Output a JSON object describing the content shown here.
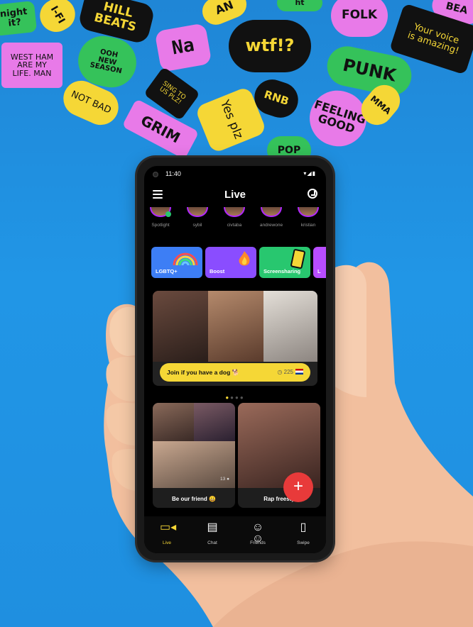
{
  "stickers": [
    {
      "text": "night\nit?",
      "bg": "#35c25a",
      "fg": "#111111"
    },
    {
      "text": "I-FI",
      "bg": "#f5d736",
      "fg": "#111111"
    },
    {
      "text": "HILL\nBEATS",
      "bg": "#111111",
      "fg": "#f5d736"
    },
    {
      "text": "AN",
      "bg": "#f5d736",
      "fg": "#111111"
    },
    {
      "text": "ht",
      "bg": "#35c25a",
      "fg": "#111111"
    },
    {
      "text": "FOLK",
      "bg": "#e87ae8",
      "fg": "#111111"
    },
    {
      "text": "BEA",
      "bg": "#e87ae8",
      "fg": "#111111"
    },
    {
      "text": "WEST HAM\nARE MY\nLIFE. MAN",
      "bg": "#e87ae8",
      "fg": "#111111"
    },
    {
      "text": "OOH\nNEW\nSEASON",
      "bg": "#35c25a",
      "fg": "#111111"
    },
    {
      "text": "Na",
      "bg": "#e87ae8",
      "fg": "#111111"
    },
    {
      "text": "wtf!?",
      "bg": "#111111",
      "fg": "#f5d736"
    },
    {
      "text": "Your voice\nis amazing!",
      "bg": "#111111",
      "fg": "#f5d736"
    },
    {
      "text": "PUNK",
      "bg": "#35c25a",
      "fg": "#111111"
    },
    {
      "text": "NOT BAD",
      "bg": "#f5d736",
      "fg": "#111111"
    },
    {
      "text": "SING TO\nUS PLZ!",
      "bg": "#111111",
      "fg": "#f5d736"
    },
    {
      "text": "RNB",
      "bg": "#111111",
      "fg": "#f5d736"
    },
    {
      "text": "FEELING\nGOOD",
      "bg": "#e87ae8",
      "fg": "#111111"
    },
    {
      "text": "MMA",
      "bg": "#f5d736",
      "fg": "#111111"
    },
    {
      "text": "Yes plz",
      "bg": "#f5d736",
      "fg": "#111111"
    },
    {
      "text": "GRIM",
      "bg": "#e87ae8",
      "fg": "#111111"
    },
    {
      "text": "POP",
      "bg": "#35c25a",
      "fg": "#111111"
    }
  ],
  "status": {
    "time": "11:40",
    "icons": "▾◢▮"
  },
  "header": {
    "title": "Live"
  },
  "stories": [
    {
      "label": "Spotlight"
    },
    {
      "label": "sybil"
    },
    {
      "label": "civtaba"
    },
    {
      "label": "andrewone"
    },
    {
      "label": "kristian"
    }
  ],
  "categories": [
    {
      "label": "LGBTQ+",
      "color": "#3d7ef5"
    },
    {
      "label": "Boost",
      "color": "#8a4dff"
    },
    {
      "label": "Screensharing",
      "color": "#28c76f"
    },
    {
      "label": "L",
      "color": "#b84dff"
    }
  ],
  "featured": {
    "text": "Join if you have a dog 🐕",
    "count": "◷ 225"
  },
  "rooms": [
    {
      "label": "Be our friend 😀",
      "count": "13 ●"
    },
    {
      "label": "Rap freesty"
    }
  ],
  "fab": {
    "label": "+"
  },
  "nav": [
    {
      "label": "Live",
      "icon": "▭◂"
    },
    {
      "label": "Chat",
      "icon": "▤"
    },
    {
      "label": "Friends",
      "icon": "☺☺"
    },
    {
      "label": "Swipe",
      "icon": "▯"
    }
  ],
  "colors": {
    "accent": "#f5d736",
    "fab": "#e83a3a",
    "sky": "#1f8fe0"
  }
}
